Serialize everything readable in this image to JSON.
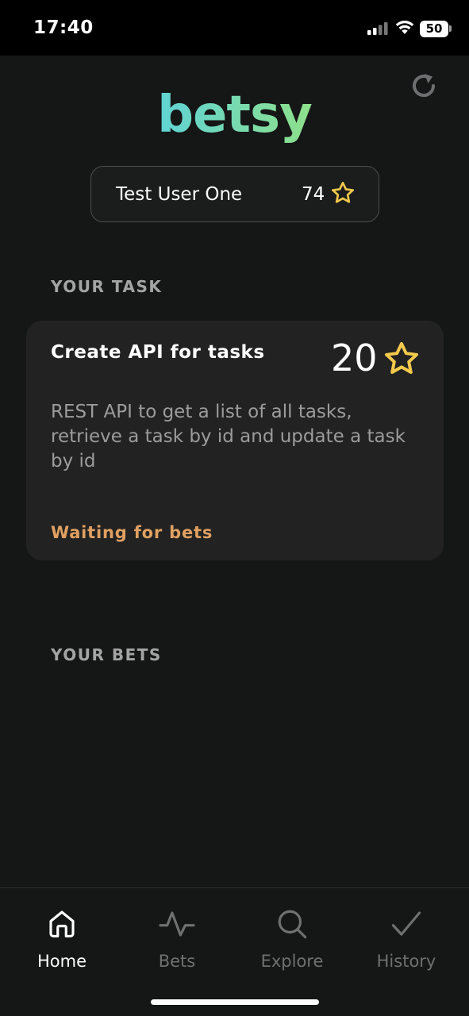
{
  "status_bar": {
    "time": "17:40",
    "battery": "50",
    "icons": [
      "signal-icon",
      "wifi-icon",
      "battery-icon"
    ]
  },
  "header": {
    "logo": "betsy",
    "logo_colors": [
      "#5fd3d6",
      "#8ee08a"
    ],
    "refresh_icon": "refresh-icon"
  },
  "user": {
    "name": "Test User One",
    "points": "74",
    "points_icon": "star-icon"
  },
  "your_task": {
    "section_title": "YOUR TASK",
    "title": "Create API for tasks",
    "points": "20",
    "points_icon": "star-icon",
    "description": "REST API to get a list of all tasks, retrieve a task by id and update a task by id",
    "status": "Waiting for bets",
    "status_color": "#e0a061"
  },
  "your_bets": {
    "section_title": "YOUR BETS"
  },
  "nav": {
    "items": [
      {
        "label": "Home",
        "icon": "home-icon",
        "active": true
      },
      {
        "label": "Bets",
        "icon": "activity-icon",
        "active": false
      },
      {
        "label": "Explore",
        "icon": "search-icon",
        "active": false
      },
      {
        "label": "History",
        "icon": "check-icon",
        "active": false
      }
    ],
    "active_color": "#ffffff",
    "inactive_color": "#6f7070"
  },
  "colors": {
    "background": "#151616",
    "card": "#222222",
    "star": "#f2c94c"
  }
}
